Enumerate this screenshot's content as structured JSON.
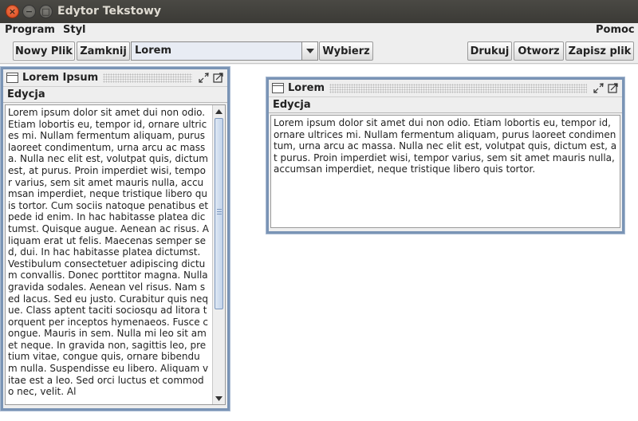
{
  "window": {
    "title": "Edytor Tekstowy",
    "close_glyph": "×",
    "minimize_glyph": "−",
    "maximize_glyph": "□"
  },
  "menubar": {
    "program": "Program",
    "styl": "Styl",
    "pomoc": "Pomoc"
  },
  "toolbar": {
    "new_file": "Nowy Plik",
    "close": "Zamknij",
    "combo_value": "Lorem",
    "choose": "Wybierz",
    "print": "Drukuj",
    "open": "Otworz",
    "save": "Zapisz plik"
  },
  "frame_left": {
    "title": "Lorem Ipsum",
    "menu": "Edycja",
    "text": "Lorem ipsum dolor sit amet dui non odio. Etiam lobortis eu, tempor id, ornare ultrices mi. Nullam fermentum aliquam, purus laoreet condimentum, urna arcu ac massa. Nulla nec elit est, volutpat quis, dictum est, at purus. Proin imperdiet wisi, tempor varius, sem sit amet mauris nulla, accumsan imperdiet, neque tristique libero quis tortor. Cum sociis natoque penatibus et pede id enim. In hac habitasse platea dictumst. Quisque augue. Aenean ac risus. Aliquam erat ut felis. Maecenas semper sed, dui. In hac habitasse platea dictumst. Vestibulum consectetuer adipiscing dictum convallis. Donec porttitor magna. Nulla gravida sodales. Aenean vel risus. Nam sed lacus. Sed eu justo. Curabitur quis neque. Class aptent taciti sociosqu ad litora torquent per inceptos hymenaeos. Fusce congue. Mauris in sem. Nulla mi leo sit amet neque. In gravida non, sagittis leo, pretium vitae, congue quis, ornare bibendum nulla. Suspendisse eu libero. Aliquam vitae est a leo. Sed orci luctus et commodo nec, velit. Al"
  },
  "frame_right": {
    "title": "Lorem",
    "menu": "Edycja",
    "text": "Lorem ipsum dolor sit amet dui non odio. Etiam lobortis eu, tempor id, ornare ultrices mi. Nullam fermentum aliquam, purus laoreet condimentum, urna arcu ac massa. Nulla nec elit est, volutpat quis, dictum est, at purus. Proin imperdiet wisi, tempor varius, sem sit amet mauris nulla, accumsan imperdiet, neque tristique libero quis tortor."
  },
  "icons": {
    "frame": "frame-icon",
    "iconify": "iconify-icon",
    "maximize": "maximize-icon",
    "combo_arrow": "chevron-down-icon",
    "scroll_up": "scroll-up-arrow-icon",
    "scroll_down": "scroll-down-arrow-icon"
  },
  "colors": {
    "titlebar": "#3c3b37",
    "close_button": "#e8562a",
    "frame_border": "#7a94b5",
    "scroll_thumb": "#c2d3ea"
  },
  "scroll": {
    "left_text_position": 0
  }
}
